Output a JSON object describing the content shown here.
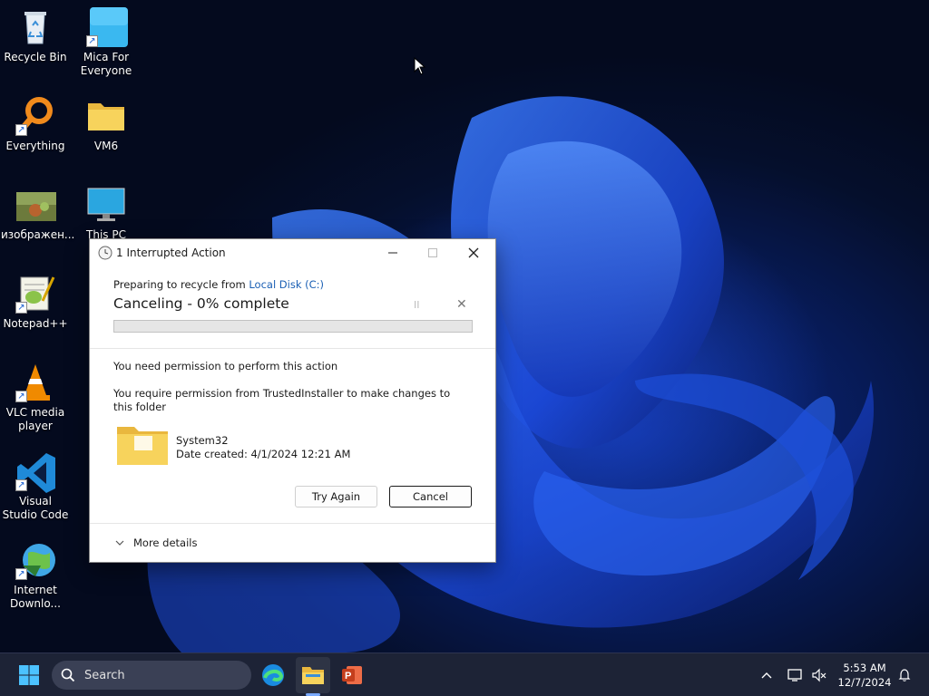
{
  "desktop": {
    "icons": [
      {
        "label": "Recycle Bin",
        "icon": "recycle-bin-icon"
      },
      {
        "label": "Mica For Everyone",
        "icon": "mica-app-icon"
      },
      {
        "label": "Everything",
        "icon": "everything-search-icon"
      },
      {
        "label": "VM6",
        "icon": "folder-icon"
      },
      {
        "label": "изображен...",
        "icon": "image-file-icon"
      },
      {
        "label": "This PC",
        "icon": "monitor-icon"
      },
      {
        "label": "Notepad++",
        "icon": "notepadpp-icon"
      },
      {
        "label": "VLC media player",
        "icon": "vlc-cone-icon"
      },
      {
        "label": "Visual Studio Code",
        "icon": "vscode-icon"
      },
      {
        "label": "Internet Downlo...",
        "icon": "idm-globe-icon"
      }
    ]
  },
  "dialog": {
    "title": "1 Interrupted Action",
    "preparing_prefix": "Preparing to recycle from ",
    "preparing_location": "Local Disk (C:)",
    "progress_title": "Canceling - 0% complete",
    "progress_percent": 0,
    "pause_symbol": "II",
    "stop_symbol": "✕",
    "permission_title": "You need permission to perform this action",
    "permission_detail": "You require permission from TrustedInstaller to make changes to this folder",
    "item_name": "System32",
    "item_date": "Date created: 4/1/2024 12:21 AM",
    "try_again_label": "Try Again",
    "cancel_label": "Cancel",
    "more_details_label": "More details",
    "colors": {
      "link": "#1a5fb4",
      "progress": "#06b025"
    }
  },
  "taskbar": {
    "search_placeholder": "Search",
    "time": "5:53 AM",
    "date": "12/7/2024",
    "tray_chevron": "^"
  }
}
